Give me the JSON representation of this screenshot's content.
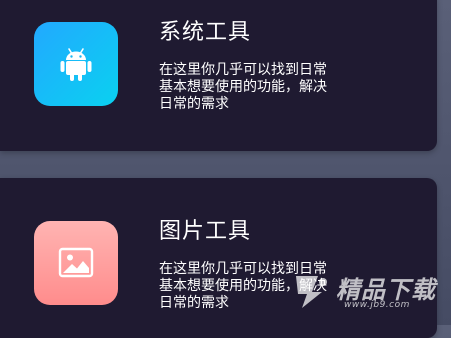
{
  "cards": [
    {
      "title": "系统工具",
      "description": "在这里你几乎可以找到日常基本想要使用的功能，解决日常的需求",
      "icon": "android-icon",
      "gradient": [
        "#22a9ff",
        "#0ad1f0"
      ]
    },
    {
      "title": "图片工具",
      "description": "在这里你几乎可以找到日常基本想要使用的功能，解决日常的需求",
      "icon": "image-icon",
      "gradient": [
        "#ffb4b2",
        "#ff8c8c"
      ]
    }
  ],
  "watermark": {
    "name": "精品下载",
    "url": "www.jb9.com"
  },
  "colors": {
    "card_background": "#1f1a31",
    "page_background": "#4f556d",
    "text": "#ffffff"
  }
}
